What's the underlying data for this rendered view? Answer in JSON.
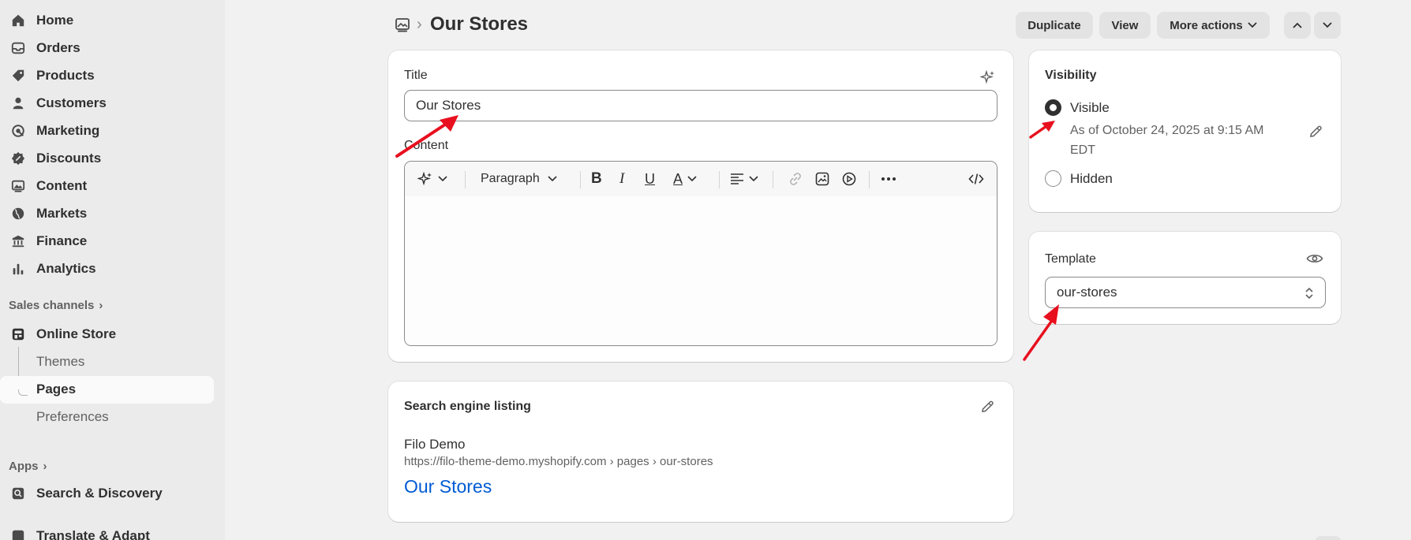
{
  "sidebar": {
    "items": [
      {
        "label": "Home",
        "icon": "home-icon"
      },
      {
        "label": "Orders",
        "icon": "inbox-icon"
      },
      {
        "label": "Products",
        "icon": "tag-icon"
      },
      {
        "label": "Customers",
        "icon": "person-icon"
      },
      {
        "label": "Marketing",
        "icon": "target-icon"
      },
      {
        "label": "Discounts",
        "icon": "discount-icon"
      },
      {
        "label": "Content",
        "icon": "image-icon"
      },
      {
        "label": "Markets",
        "icon": "globe-icon"
      },
      {
        "label": "Finance",
        "icon": "bank-icon"
      },
      {
        "label": "Analytics",
        "icon": "chart-icon"
      }
    ],
    "sales_channels_label": "Sales channels",
    "online_store": {
      "label": "Online Store",
      "icon": "store-icon"
    },
    "online_store_sub": [
      "Themes",
      "Pages",
      "Preferences"
    ],
    "apps_label": "Apps",
    "apps": [
      {
        "label": "Search & Discovery",
        "icon": "search-discovery-icon"
      },
      {
        "label": "Translate & Adapt",
        "icon": "translate-icon"
      }
    ]
  },
  "header": {
    "title": "Our Stores",
    "buttons": {
      "duplicate": "Duplicate",
      "view": "View",
      "more_actions": "More actions"
    }
  },
  "main": {
    "title_label": "Title",
    "title_value": "Our Stores",
    "content_label": "Content",
    "paragraph_select": "Paragraph"
  },
  "seo": {
    "heading": "Search engine listing",
    "store_name": "Filo Demo",
    "url": "https://filo-theme-demo.myshopify.com › pages › our-stores",
    "page_title": "Our Stores"
  },
  "visibility": {
    "heading": "Visibility",
    "visible_label": "Visible",
    "visible_note_line1": "As of October 24, 2025 at 9:15 AM",
    "visible_note_line2": "EDT",
    "hidden_label": "Hidden",
    "selected": "visible"
  },
  "template": {
    "label": "Template",
    "value": "our-stores"
  },
  "colors": {
    "accent_link": "#005bd3",
    "annotation_arrow": "#e8101e"
  }
}
